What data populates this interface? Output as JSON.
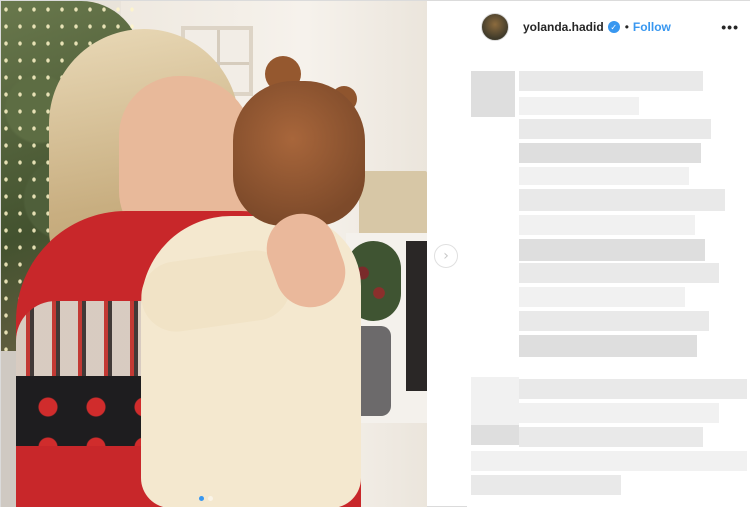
{
  "post": {
    "username": "yolanda.hadid",
    "verified_mark": "✓",
    "separator": "•",
    "follow_label": "Follow",
    "more_label": "•••",
    "next_arrow": "›",
    "carousel": {
      "total": 2,
      "active": 0
    }
  },
  "colors": {
    "accent": "#3897f0",
    "text": "#262626",
    "border": "#dbdbdb"
  }
}
